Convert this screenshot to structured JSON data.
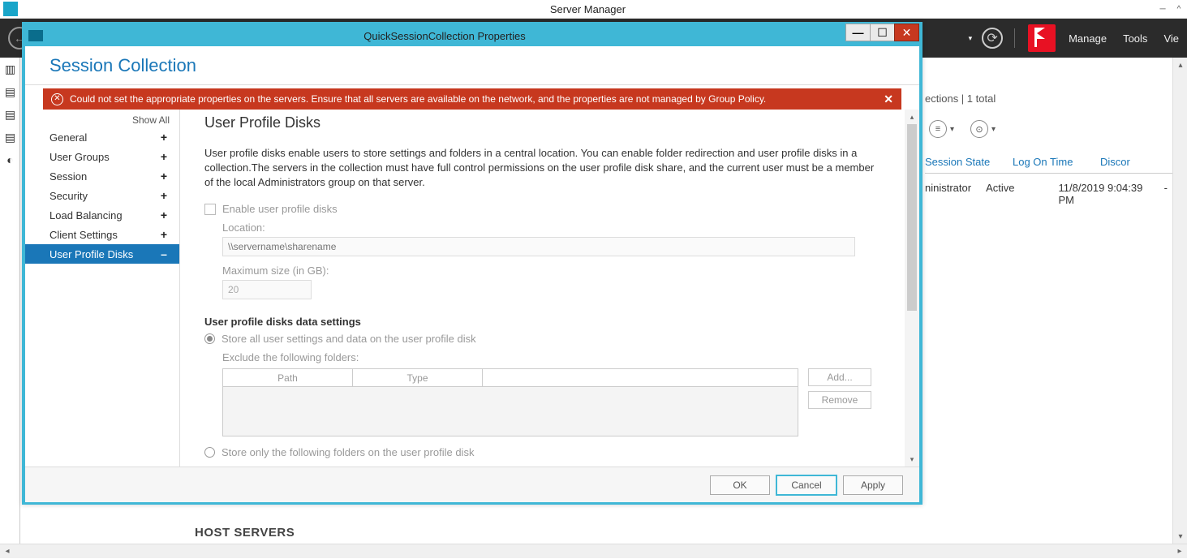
{
  "outer": {
    "title": "Server Manager"
  },
  "ribbon": {
    "manage": "Manage",
    "tools": "Tools",
    "view": "Vie"
  },
  "bg": {
    "tasks_label": "ections  |  1 total",
    "cols": {
      "state": "Session State",
      "logon": "Log On Time",
      "disc": "Discor"
    },
    "row": {
      "user": "ninistrator",
      "state": "Active",
      "logon": "11/8/2019 9:04:39 PM",
      "disc": "-"
    }
  },
  "host_servers": "HOST SERVERS",
  "dialog": {
    "title": "QuickSessionCollection Properties",
    "header": "Session Collection",
    "error": "Could not set the appropriate properties on the servers. Ensure that all servers are available on the network, and the properties are not managed by Group Policy.",
    "show_all": "Show All",
    "nav": {
      "general": "General",
      "usergroups": "User Groups",
      "session": "Session",
      "security": "Security",
      "loadbalancing": "Load Balancing",
      "clientsettings": "Client Settings",
      "upd": "User Profile Disks"
    },
    "content": {
      "title": "User Profile Disks",
      "desc": "User profile disks enable users to store settings and folders in a central location. You can enable folder redirection and user profile disks in a collection.The servers in the collection must have full control permissions on the user profile disk share, and the current user must be a member of the local Administrators group on that server.",
      "enable_label": "Enable user profile disks",
      "location_label": "Location:",
      "location_placeholder": "\\\\servername\\sharename",
      "maxsize_label": "Maximum size (in GB):",
      "maxsize_value": "20",
      "section": "User profile disks data settings",
      "radio1": "Store all user settings and data on the user profile disk",
      "exclude_label": "Exclude the following folders:",
      "th_path": "Path",
      "th_type": "Type",
      "btn_add": "Add...",
      "btn_remove": "Remove",
      "radio2": "Store only the following folders on the user profile disk"
    },
    "footer": {
      "ok": "OK",
      "cancel": "Cancel",
      "apply": "Apply"
    }
  }
}
